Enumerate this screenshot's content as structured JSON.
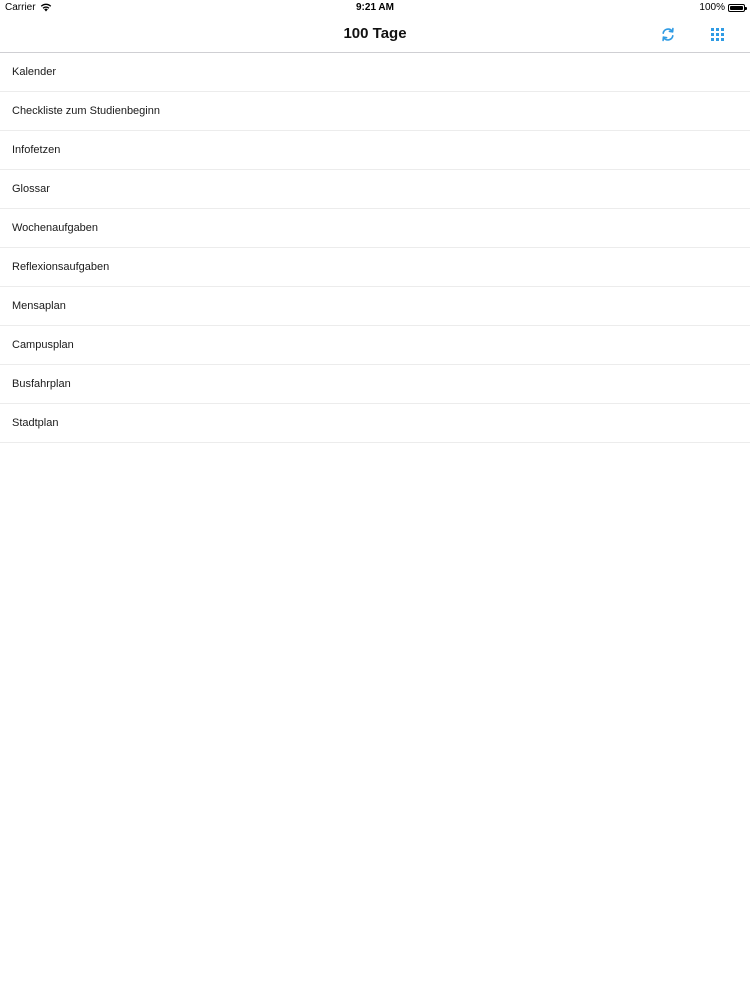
{
  "status_bar": {
    "carrier": "Carrier",
    "time": "9:21 AM",
    "battery": "100%"
  },
  "nav_bar": {
    "title": "100 Tage",
    "accent_color": "#2f9be4",
    "refresh_icon": "refresh-icon",
    "grid_icon": "grid-icon"
  },
  "menu": {
    "items": [
      {
        "label": "Kalender"
      },
      {
        "label": "Checkliste zum Studienbeginn"
      },
      {
        "label": "Infofetzen"
      },
      {
        "label": "Glossar"
      },
      {
        "label": "Wochenaufgaben"
      },
      {
        "label": "Reflexionsaufgaben"
      },
      {
        "label": "Mensaplan"
      },
      {
        "label": "Campusplan"
      },
      {
        "label": "Busfahrplan"
      },
      {
        "label": "Stadtplan"
      }
    ]
  }
}
